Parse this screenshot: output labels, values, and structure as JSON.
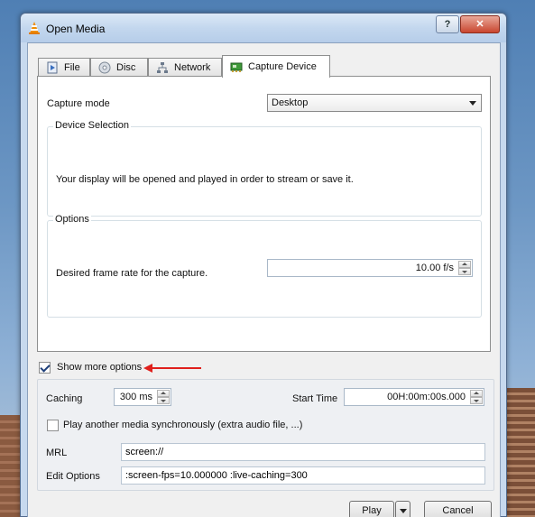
{
  "window": {
    "title": "Open Media",
    "help_label": "?",
    "close_label": "✕"
  },
  "tabs": [
    {
      "label": "File",
      "icon": "file-play-icon"
    },
    {
      "label": "Disc",
      "icon": "disc-icon"
    },
    {
      "label": "Network",
      "icon": "network-icon"
    },
    {
      "label": "Capture Device",
      "icon": "capture-card-icon",
      "active": true
    }
  ],
  "capture": {
    "mode_label": "Capture mode",
    "mode_value": "Desktop",
    "device_group_title": "Device Selection",
    "device_description": "Your display will be opened and played in order to stream or save it.",
    "options_group_title": "Options",
    "frame_rate_label": "Desired frame rate for the capture.",
    "frame_rate_value": "10.00 f/s"
  },
  "show_more": {
    "label": "Show more options",
    "checked": true,
    "annotation_arrow_color": "#e0201c"
  },
  "more_options": {
    "caching_label": "Caching",
    "caching_value": "300 ms",
    "start_time_label": "Start Time",
    "start_time_value": "00H:00m:00s.000",
    "sync_label": "Play another media synchronously (extra audio file, ...)",
    "sync_checked": false,
    "mrl_label": "MRL",
    "mrl_value": "screen://",
    "edit_options_label": "Edit Options",
    "edit_options_value": ":screen-fps=10.000000 :live-caching=300"
  },
  "buttons": {
    "play": "Play",
    "cancel": "Cancel"
  }
}
